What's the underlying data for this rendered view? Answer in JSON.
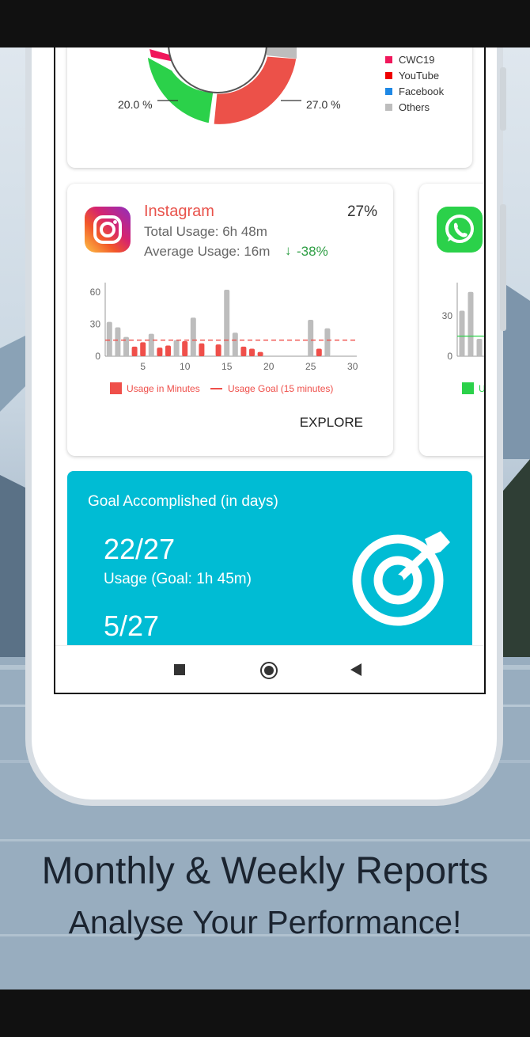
{
  "donut": {
    "left_pct": "20.0 %",
    "right_pct": "27.0 %",
    "legend": [
      {
        "label": "CWC19",
        "color": "#f0175b"
      },
      {
        "label": "YouTube",
        "color": "#ee0000"
      },
      {
        "label": "Facebook",
        "color": "#1e88e5"
      },
      {
        "label": "Others",
        "color": "#bdbdbd"
      }
    ]
  },
  "instagram": {
    "name": "Instagram",
    "percent": "27%",
    "total": "Total Usage: 6h 48m",
    "average": "Average Usage: 16m",
    "change": "-38%",
    "explore": "EXPLORE",
    "legend_usage": "Usage in Minutes",
    "legend_goal": "Usage Goal (15 minutes)"
  },
  "whatsapp": {
    "legend_usage": "U"
  },
  "goal_card": {
    "title": "Goal Accomplished (in days)",
    "stat1": "22/27",
    "stat1_label": "Usage (Goal: 1h 45m)",
    "stat2": "5/27"
  },
  "caption": {
    "title": "Monthly & Weekly Reports",
    "subtitle": "Analyse Your Performance!"
  },
  "chart_data": [
    {
      "type": "bar",
      "title": "",
      "x": [
        1,
        2,
        3,
        4,
        5,
        6,
        7,
        8,
        9,
        10,
        11,
        12,
        13,
        14,
        15,
        16,
        17,
        18,
        19,
        20,
        21,
        22,
        23,
        24,
        25,
        26,
        27,
        28,
        29,
        30
      ],
      "xticks": [
        "5",
        "10",
        "15",
        "20",
        "25",
        "30"
      ],
      "yticks": [
        "0",
        "30",
        "60"
      ],
      "ylim": [
        0,
        65
      ],
      "goal": 15,
      "series": [
        {
          "name": "Usage in Minutes",
          "values": [
            32,
            27,
            18,
            9,
            13,
            21,
            8,
            10,
            15,
            14,
            36,
            12,
            0,
            11,
            62,
            22,
            9,
            7,
            4,
            0,
            0,
            0,
            0,
            0,
            34,
            7,
            26,
            0,
            0,
            0
          ],
          "below_goal_color": "#ef4f4a",
          "above_goal_color": "#bdbdbd"
        }
      ]
    },
    {
      "type": "bar",
      "title": "",
      "yticks": [
        "0",
        "30"
      ],
      "values_visible": [
        34,
        48,
        13
      ],
      "color": "#bdbdbd"
    }
  ],
  "colors": {
    "goal_bg": "#00bcd4",
    "instagram_name": "#e8524b",
    "change_green": "#2e9e44",
    "goal_line": "#ef4f4a"
  }
}
